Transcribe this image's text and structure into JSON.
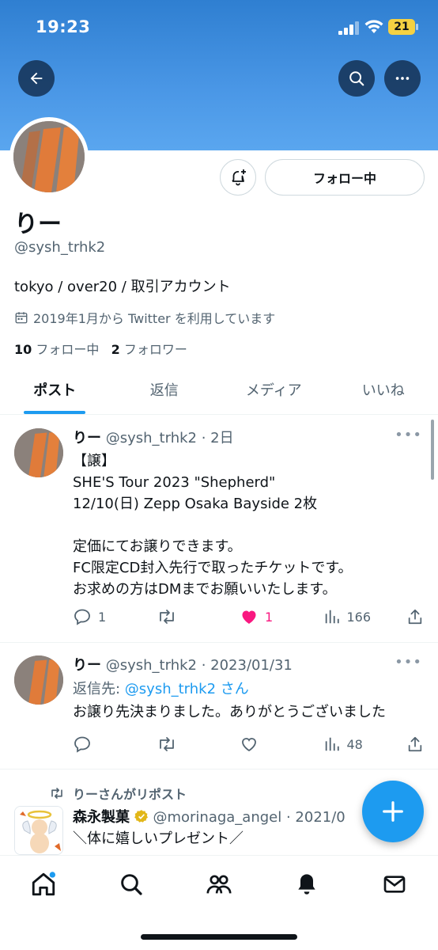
{
  "status_bar": {
    "time": "19:23",
    "battery": "21"
  },
  "profile": {
    "display_name": "りー",
    "handle": "@sysh_trhk2",
    "bio": "tokyo / over20 / 取引アカウント",
    "joined": "2019年1月から Twitter を利用しています",
    "following_count": "10",
    "following_label": "フォロー中",
    "followers_count": "2",
    "followers_label": "フォロワー",
    "follow_button": "フォロー中"
  },
  "tabs": [
    {
      "label": "ポスト",
      "active": true
    },
    {
      "label": "返信",
      "active": false
    },
    {
      "label": "メディア",
      "active": false
    },
    {
      "label": "いいね",
      "active": false
    }
  ],
  "posts": [
    {
      "name": "りー",
      "meta": "@sysh_trhk2 · 2日",
      "text": "【譲】\nSHE'S Tour 2023 \"Shepherd\"\n12/10(日) Zepp Osaka Bayside 2枚\n\n定価にてお譲りできます。\nFC限定CD封入先行で取ったチケットです。\nお求めの方はDMまでお願いいたします。",
      "replies": "1",
      "reposts": "",
      "likes": "1",
      "views": "166"
    },
    {
      "name": "りー",
      "meta": "@sysh_trhk2 · 2023/01/31",
      "reply_to_prefix": "返信先: ",
      "reply_to": "@sysh_trhk2 さん",
      "text": "お譲り先決まりました。ありがとうございました",
      "replies": "",
      "reposts": "",
      "likes": "",
      "views": "48"
    }
  ],
  "repost": {
    "label": "りーさんがリポスト",
    "name": "森永製菓",
    "meta": "@morinaga_angel · 2021/0",
    "text": "＼体に嬉しいプレゼント／"
  },
  "colors": {
    "accent": "#1d9bf0",
    "like": "#f91880",
    "banner": "#4a97e6"
  }
}
